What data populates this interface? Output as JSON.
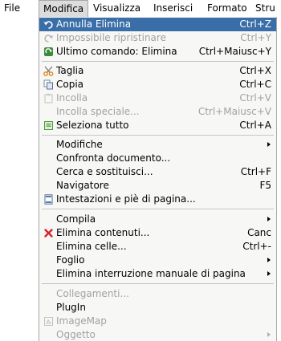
{
  "menubar": {
    "file": "File",
    "modifica": "Modifica",
    "visualizza": "Visualizza",
    "inserisci": "Inserisci",
    "formato": "Formato",
    "strumenti": "Stru"
  },
  "menu": {
    "annulla": {
      "label": "Annulla Elimina",
      "shortcut": "Ctrl+Z",
      "icon": "undo-icon"
    },
    "ripristina": {
      "label": "Impossibile ripristinare",
      "shortcut": "Ctrl+Y",
      "icon": "redo-icon"
    },
    "ultimo": {
      "label": "Ultimo comando: Elimina",
      "shortcut": "Ctrl+Maiusc+Y",
      "icon": "repeat-icon"
    },
    "taglia": {
      "label": "Taglia",
      "shortcut": "Ctrl+X",
      "icon": "scissors-icon"
    },
    "copia": {
      "label": "Copia",
      "shortcut": "Ctrl+C",
      "icon": "copy-icon"
    },
    "incolla": {
      "label": "Incolla",
      "shortcut": "Ctrl+V",
      "icon": "paste-icon"
    },
    "incolla_speciale": {
      "label": "Incolla speciale...",
      "shortcut": "Ctrl+Maiusc+V"
    },
    "seleziona_tutto": {
      "label": "Seleziona tutto",
      "shortcut": "Ctrl+A",
      "icon": "select-all-icon"
    },
    "modifiche": {
      "label": "Modifiche"
    },
    "confronta": {
      "label": "Confronta documento..."
    },
    "cerca": {
      "label": "Cerca e sostituisci...",
      "shortcut": "Ctrl+F"
    },
    "navigatore": {
      "label": "Navigatore",
      "shortcut": "F5"
    },
    "intestazioni": {
      "label": "Intestazioni e piè di pagina...",
      "icon": "header-footer-icon"
    },
    "compila": {
      "label": "Compila"
    },
    "elimina_contenuti": {
      "label": "Elimina contenuti...",
      "shortcut": "Canc",
      "icon": "delete-x-icon"
    },
    "elimina_celle": {
      "label": "Elimina celle...",
      "shortcut": "Ctrl+-"
    },
    "foglio": {
      "label": "Foglio"
    },
    "elimina_interruzione": {
      "label": "Elimina interruzione manuale di pagina"
    },
    "collegamenti": {
      "label": "Collegamenti..."
    },
    "plugin": {
      "label": "PlugIn"
    },
    "imagemap": {
      "label": "ImageMap",
      "icon": "imagemap-icon"
    },
    "oggetto": {
      "label": "Oggetto"
    }
  },
  "colors": {
    "highlight": "#3a6ea8",
    "menu_background": "#f7f7f5",
    "disabled_text": "#a2a2a2"
  }
}
